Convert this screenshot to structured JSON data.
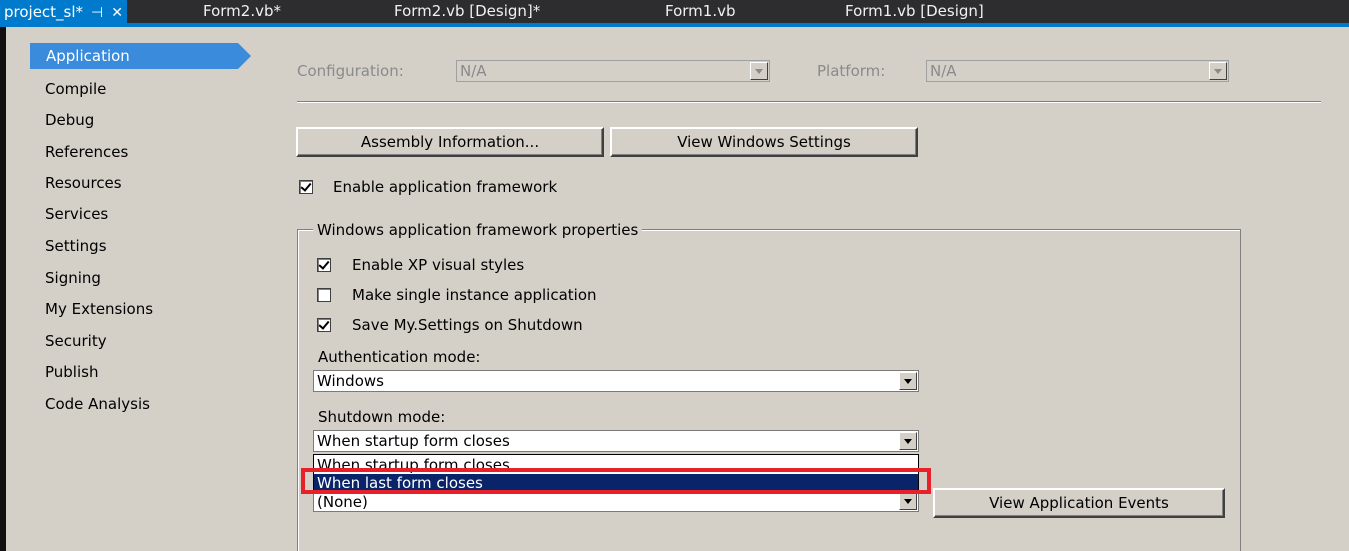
{
  "tabs": [
    {
      "label": "project_sl*",
      "active": true
    },
    {
      "label": "Form2.vb*"
    },
    {
      "label": "Form2.vb [Design]*"
    },
    {
      "label": "Form1.vb"
    },
    {
      "label": "Form1.vb [Design]"
    }
  ],
  "tab_icons": {
    "pin": "⊣",
    "close": "✕"
  },
  "sidebar": {
    "items": [
      {
        "label": "Application"
      },
      {
        "label": "Compile"
      },
      {
        "label": "Debug"
      },
      {
        "label": "References"
      },
      {
        "label": "Resources"
      },
      {
        "label": "Services"
      },
      {
        "label": "Settings"
      },
      {
        "label": "Signing"
      },
      {
        "label": "My Extensions"
      },
      {
        "label": "Security"
      },
      {
        "label": "Publish"
      },
      {
        "label": "Code Analysis"
      }
    ]
  },
  "config": {
    "configuration_label": "Configuration:",
    "configuration_value": "N/A",
    "platform_label": "Platform:",
    "platform_value": "N/A"
  },
  "buttons": {
    "assembly_info": "Assembly Information...",
    "view_windows_settings": "View Windows Settings",
    "view_app_events": "View Application Events"
  },
  "enable_framework": {
    "label": "Enable application framework",
    "checked": true
  },
  "group": {
    "title": "Windows application framework properties",
    "xp_styles": {
      "label": "Enable XP visual styles",
      "checked": true
    },
    "single_instance": {
      "label": "Make single instance application",
      "checked": false
    },
    "save_settings": {
      "label": "Save My.Settings on Shutdown",
      "checked": true
    },
    "auth_label": "Authentication mode:",
    "auth_value": "Windows",
    "shutdown_label": "Shutdown mode:",
    "shutdown_value": "When startup form closes",
    "shutdown_options": [
      "When startup form closes",
      "When last form closes"
    ],
    "splash_value": "(None)"
  },
  "colors": {
    "accent": "#007acc",
    "highlight": "#e8202a",
    "selection": "#0a246a"
  }
}
